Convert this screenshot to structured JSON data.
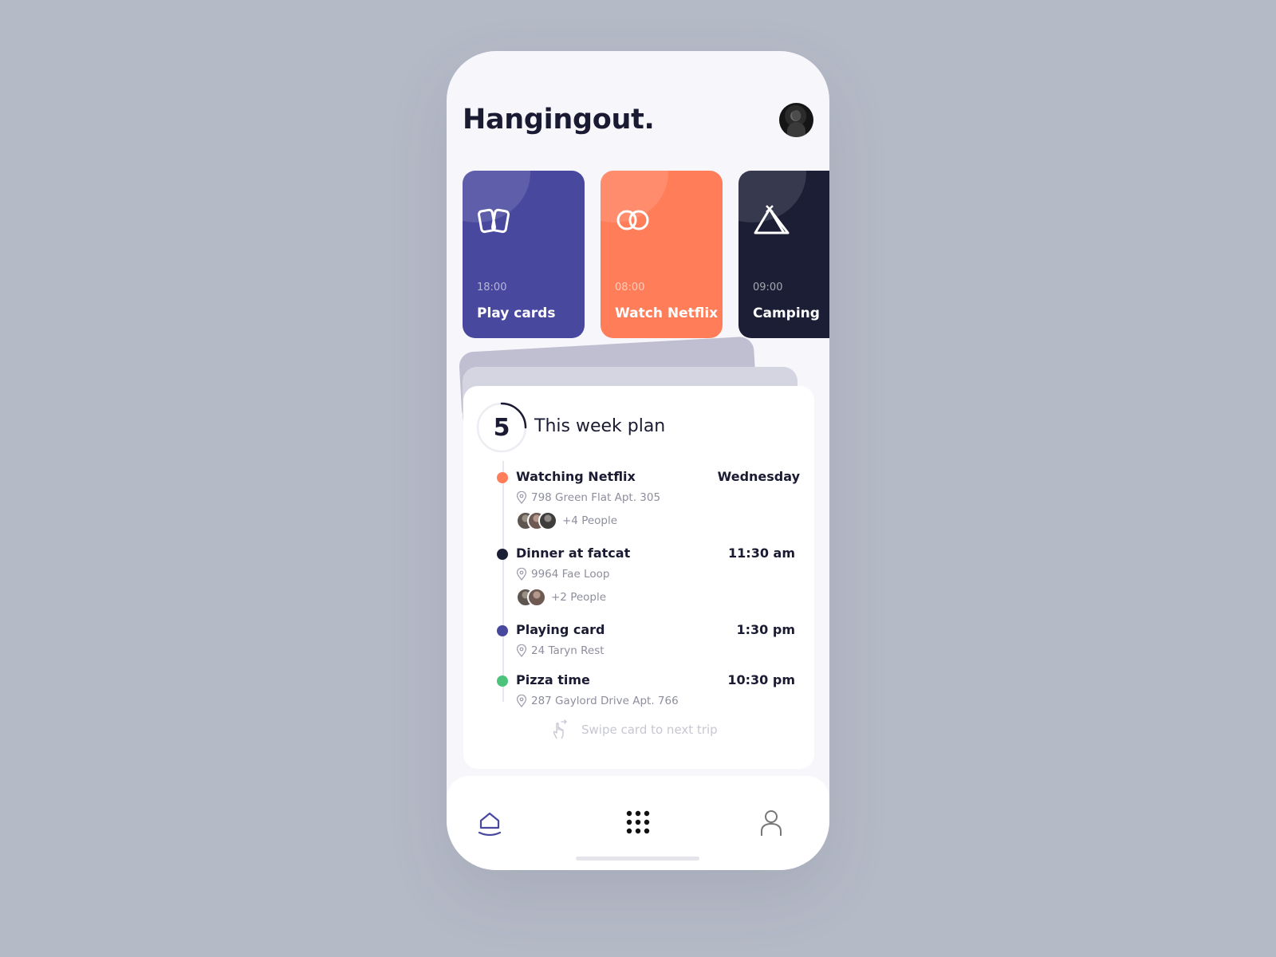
{
  "app": {
    "title": "Hangingout."
  },
  "colors": {
    "background": "#b5bac7",
    "screen": "#f6f6fb",
    "indigo": "#48489f",
    "coral": "#ff7d59",
    "navy": "#1c1e36",
    "green": "#4cc37a"
  },
  "activities": [
    {
      "time": "18:00",
      "label": "Play cards",
      "icon": "cards-icon"
    },
    {
      "time": "08:00",
      "label": "Watch Netflix",
      "icon": "rings-icon"
    },
    {
      "time": "09:00",
      "label": "Camping",
      "icon": "tent-icon"
    }
  ],
  "plan": {
    "count": "5",
    "title": "This week plan",
    "events": [
      {
        "name": "Watching Netflix",
        "when": "Wednesday",
        "address": "798 Green Flat Apt. 305",
        "people": "+4 People"
      },
      {
        "name": "Dinner at fatcat",
        "when": "11:30 am",
        "address": "9964 Fae Loop",
        "people": "+2 People"
      },
      {
        "name": "Playing card",
        "when": "1:30 pm",
        "address": "24 Taryn Rest"
      },
      {
        "name": "Pizza time",
        "when": "10:30 pm",
        "address": "287 Gaylord Drive Apt. 766"
      }
    ],
    "swipe_hint": "Swipe card to next trip"
  },
  "nav": {
    "items": [
      "home-icon",
      "grid-icon",
      "user-icon"
    ]
  }
}
